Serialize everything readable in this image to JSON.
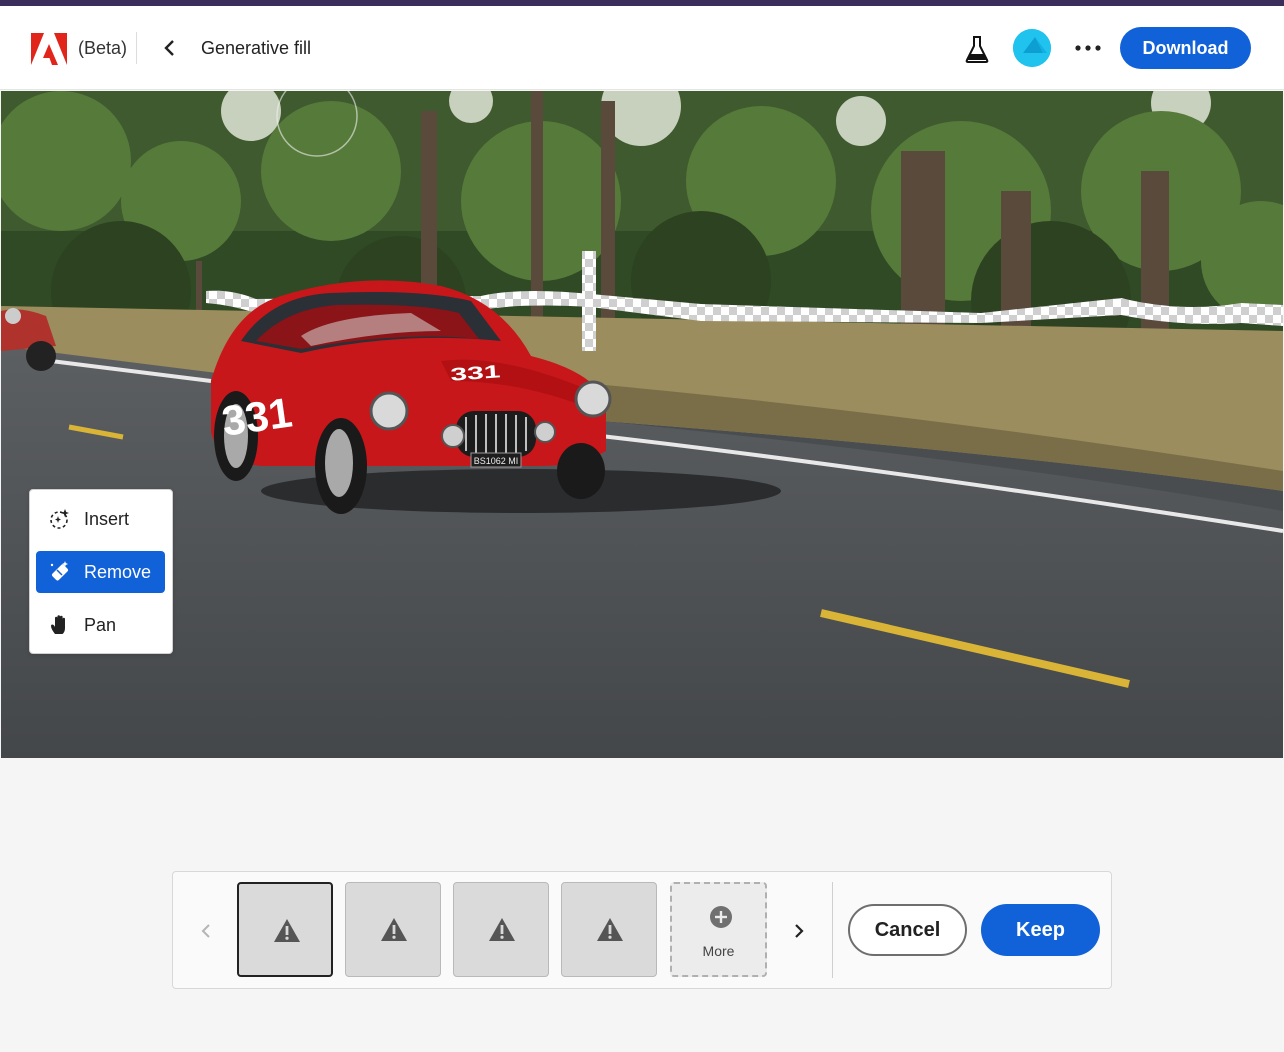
{
  "header": {
    "beta_label": "(Beta)",
    "title": "Generative fill",
    "download_label": "Download",
    "icons": [
      "adobe-logo",
      "chevron-left-icon",
      "flask-icon",
      "avatar",
      "more-icon"
    ]
  },
  "canvas": {
    "car_number_side": "331",
    "car_number_hood": "331",
    "plate_text": "BS1062 MI"
  },
  "tools": [
    {
      "label": "Insert",
      "icon": "insert-sparkle-icon",
      "active": false
    },
    {
      "label": "Remove",
      "icon": "remove-eraser-icon",
      "active": true
    },
    {
      "label": "Pan",
      "icon": "hand-icon",
      "active": false
    }
  ],
  "variations": {
    "thumbs": [
      {
        "icon": "warning-icon",
        "selected": true
      },
      {
        "icon": "warning-icon",
        "selected": false
      },
      {
        "icon": "warning-icon",
        "selected": false
      },
      {
        "icon": "warning-icon",
        "selected": false
      }
    ],
    "more_label": "More",
    "cancel_label": "Cancel",
    "keep_label": "Keep"
  },
  "colors": {
    "accent": "#1161d9",
    "top_stripe": "#3b2e5a",
    "car_red": "#c8171b"
  }
}
